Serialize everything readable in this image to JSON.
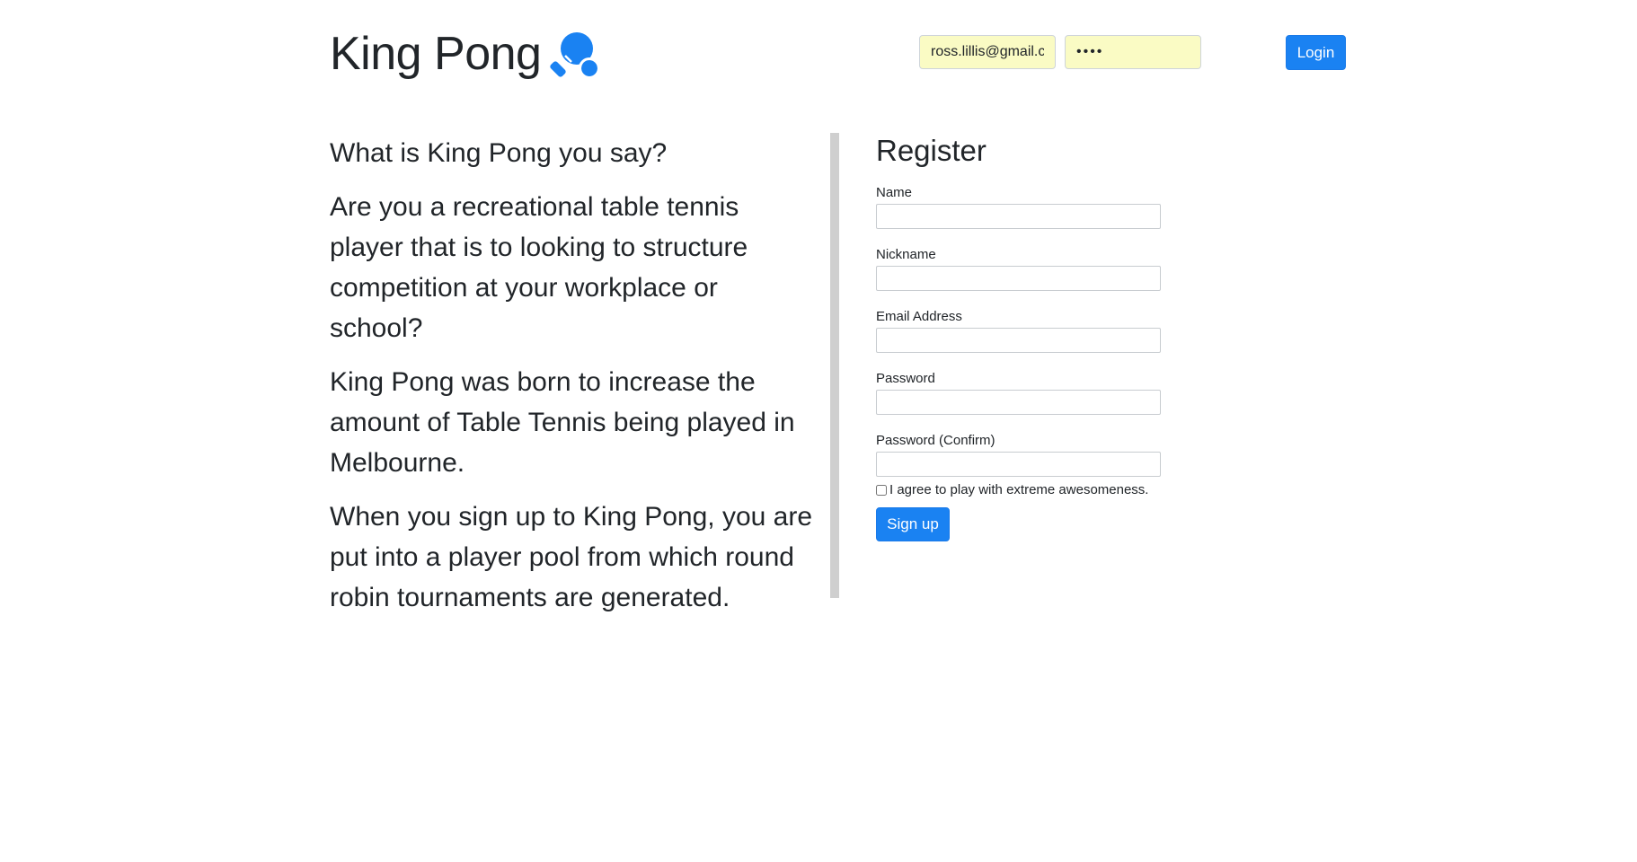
{
  "header": {
    "brand_title": "King Pong",
    "brand_icon": "ping-pong-paddle-icon",
    "login_email_value": "ross.lillis@gmail.c",
    "login_password_value": "abcd",
    "login_button_label": "Login"
  },
  "about": {
    "paragraphs": [
      "What is King Pong you say?",
      "Are you a recreational table tennis player that is to looking to structure competition at your workplace or school?",
      "King Pong was born to increase the amount of Table Tennis being played in Melbourne.",
      "When you sign up to King Pong, you are put into a player pool from which round robin tournaments are generated."
    ]
  },
  "register": {
    "title": "Register",
    "fields": {
      "name_label": "Name",
      "nickname_label": "Nickname",
      "email_label": "Email Address",
      "password_label": "Password",
      "password_confirm_label": "Password (Confirm)"
    },
    "agree_label": "I agree to play with extreme awesomeness.",
    "signup_label": "Sign up"
  },
  "colors": {
    "primary": "#1a82f2",
    "autofill": "#fafbc4",
    "divider": "#cfcfcf",
    "text": "#212529"
  }
}
